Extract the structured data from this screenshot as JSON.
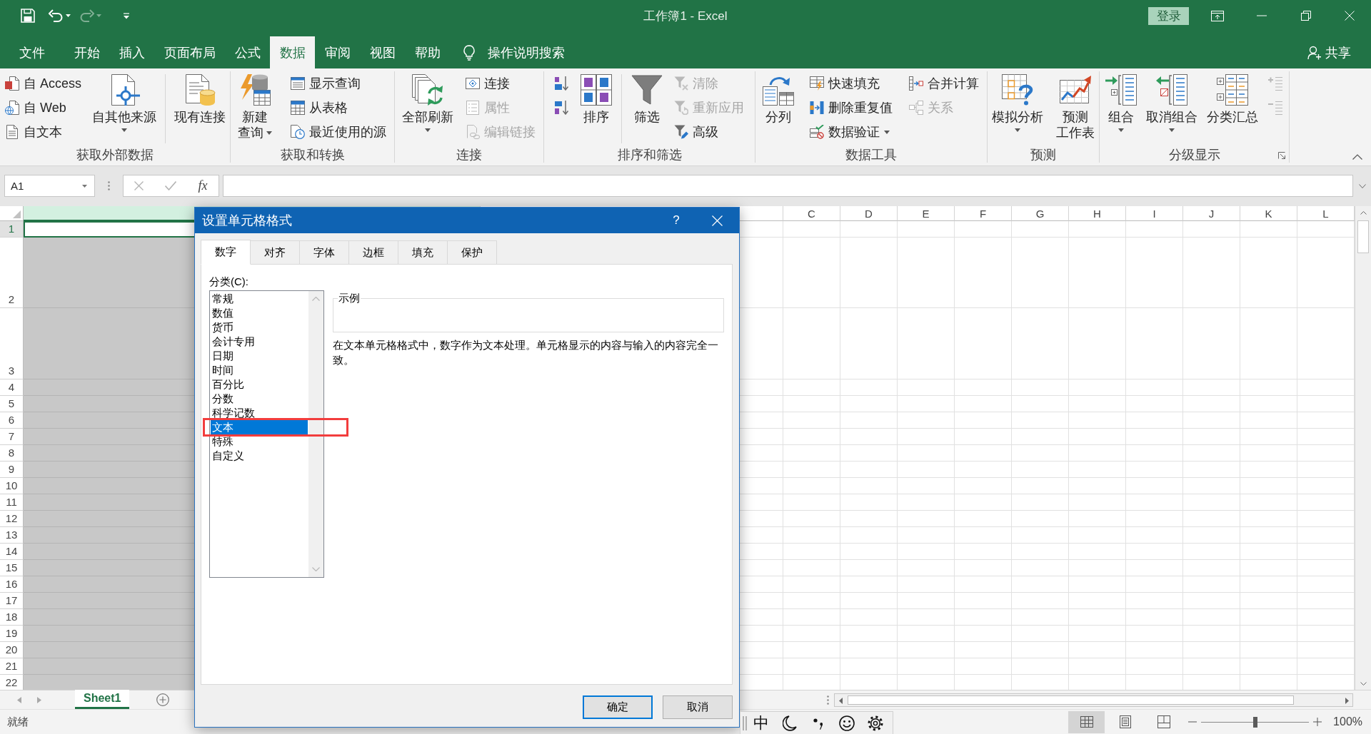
{
  "window": {
    "title": "工作簿1 - Excel",
    "sign_in": "登录"
  },
  "ribbon_tabs": [
    {
      "label": "文件",
      "selected": false
    },
    {
      "label": "开始",
      "selected": false
    },
    {
      "label": "插入",
      "selected": false
    },
    {
      "label": "页面布局",
      "selected": false
    },
    {
      "label": "公式",
      "selected": false
    },
    {
      "label": "数据",
      "selected": true
    },
    {
      "label": "审阅",
      "selected": false
    },
    {
      "label": "视图",
      "selected": false
    },
    {
      "label": "帮助",
      "selected": false
    }
  ],
  "tell_me": {
    "label": "操作说明搜索"
  },
  "share": {
    "label": "共享"
  },
  "ribbon_groups": [
    {
      "label": "获取外部数据",
      "columns": [
        {
          "kind": "stack",
          "items": [
            {
              "label": "自 Access",
              "disabled": false,
              "dropdown": false
            },
            {
              "label": "自 Web",
              "disabled": false,
              "dropdown": false
            },
            {
              "label": "自文本",
              "disabled": false,
              "dropdown": false
            }
          ]
        },
        {
          "kind": "large",
          "label_lines": [
            "自其他来源"
          ],
          "dropdown": true
        },
        {
          "kind": "separator"
        },
        {
          "kind": "large",
          "label_lines": [
            "现有连接"
          ],
          "dropdown": false
        }
      ]
    },
    {
      "label": "获取和转换",
      "columns": [
        {
          "kind": "large",
          "label_lines": [
            "新建",
            "查询"
          ],
          "dropdown": true
        },
        {
          "kind": "stack",
          "items": [
            {
              "label": "显示查询",
              "disabled": false,
              "dropdown": false
            },
            {
              "label": "从表格",
              "disabled": false,
              "dropdown": false
            },
            {
              "label": "最近使用的源",
              "disabled": false,
              "dropdown": false
            }
          ]
        }
      ]
    },
    {
      "label": "连接",
      "columns": [
        {
          "kind": "large",
          "label_lines": [
            "全部刷新"
          ],
          "dropdown": true
        },
        {
          "kind": "stack",
          "items": [
            {
              "label": "连接",
              "disabled": false,
              "dropdown": false
            },
            {
              "label": "属性",
              "disabled": true,
              "dropdown": false
            },
            {
              "label": "编辑链接",
              "disabled": true,
              "dropdown": false
            }
          ]
        }
      ]
    },
    {
      "label": "排序和筛选",
      "columns": [
        {
          "kind": "icons",
          "items": [
            {
              "disabled": false
            },
            {
              "disabled": false
            }
          ]
        },
        {
          "kind": "large",
          "label_lines": [
            "排序"
          ],
          "dropdown": false
        },
        {
          "kind": "separator"
        },
        {
          "kind": "large",
          "label_lines": [
            "筛选"
          ],
          "dropdown": false
        },
        {
          "kind": "stack",
          "items": [
            {
              "label": "清除",
              "disabled": true,
              "dropdown": false
            },
            {
              "label": "重新应用",
              "disabled": true,
              "dropdown": false
            },
            {
              "label": "高级",
              "disabled": false,
              "dropdown": false
            }
          ]
        }
      ]
    },
    {
      "label": "数据工具",
      "columns": [
        {
          "kind": "large",
          "label_lines": [
            "分列"
          ],
          "dropdown": false
        },
        {
          "kind": "stack",
          "items": [
            {
              "label": "快速填充",
              "disabled": false,
              "dropdown": false
            },
            {
              "label": "删除重复值",
              "disabled": false,
              "dropdown": false
            },
            {
              "label": "数据验证",
              "disabled": false,
              "dropdown": true
            }
          ]
        },
        {
          "kind": "stack",
          "items": [
            {
              "label": "合并计算",
              "disabled": false,
              "dropdown": false
            },
            {
              "label": "关系",
              "disabled": true,
              "dropdown": false
            }
          ]
        }
      ]
    },
    {
      "label": "预测",
      "columns": [
        {
          "kind": "large",
          "label_lines": [
            "模拟分析"
          ],
          "dropdown": true
        },
        {
          "kind": "large",
          "label_lines": [
            "预测",
            "工作表"
          ],
          "dropdown": false
        }
      ]
    },
    {
      "label": "分级显示",
      "launcher": true,
      "columns": [
        {
          "kind": "large",
          "label_lines": [
            "组合"
          ],
          "dropdown": true
        },
        {
          "kind": "large",
          "label_lines": [
            "取消组合"
          ],
          "dropdown": true
        },
        {
          "kind": "large",
          "label_lines": [
            "分类汇总"
          ],
          "dropdown": false
        },
        {
          "kind": "icons",
          "items": [
            {
              "disabled": true
            },
            {
              "disabled": true
            }
          ]
        }
      ]
    }
  ],
  "formula_bar": {
    "name_box": "A1",
    "enter_disabled": true,
    "function_label": "fx"
  },
  "sheet": {
    "columns": [
      {
        "selected": true
      },
      {
        "selected": false
      },
      {
        "label": "C",
        "selected": false
      },
      {
        "label": "D",
        "selected": false
      },
      {
        "label": "E",
        "selected": false
      },
      {
        "label": "F",
        "selected": false
      },
      {
        "label": "G",
        "selected": false
      },
      {
        "label": "H",
        "selected": false
      },
      {
        "label": "I",
        "selected": false
      },
      {
        "label": "J",
        "selected": false
      },
      {
        "label": "K",
        "selected": false
      },
      {
        "label": "L",
        "selected": false
      }
    ],
    "rows": [
      {
        "label": "1",
        "selected": true
      },
      {
        "label": "2",
        "selected": false
      },
      {
        "label": "3",
        "selected": false
      },
      {
        "label": "4",
        "selected": false
      },
      {
        "label": "5",
        "selected": false
      },
      {
        "label": "6",
        "selected": false
      },
      {
        "label": "7",
        "selected": false
      },
      {
        "label": "8",
        "selected": false
      },
      {
        "label": "9",
        "selected": false
      },
      {
        "label": "10",
        "selected": false
      },
      {
        "label": "11",
        "selected": false
      },
      {
        "label": "12",
        "selected": false
      },
      {
        "label": "13",
        "selected": false
      },
      {
        "label": "14",
        "selected": false
      },
      {
        "label": "15",
        "selected": false
      },
      {
        "label": "16",
        "selected": false
      },
      {
        "label": "17",
        "selected": false
      },
      {
        "label": "18",
        "selected": false
      },
      {
        "label": "19",
        "selected": false
      },
      {
        "label": "20",
        "selected": false
      },
      {
        "label": "21",
        "selected": false
      },
      {
        "label": "22",
        "selected": false
      }
    ]
  },
  "sheet_tabs": [
    {
      "label": "Sheet1",
      "selected": true
    }
  ],
  "status_bar": {
    "status": "就绪",
    "views": [
      {
        "selected": true
      },
      {
        "selected": false
      },
      {
        "selected": false
      }
    ],
    "zoom": {
      "level": 0.5,
      "reading": "100%"
    }
  },
  "dialog": {
    "title": "设置单元格格式",
    "help": "?",
    "tabs": [
      {
        "label": "数字",
        "selected": true
      },
      {
        "label": "对齐",
        "selected": false
      },
      {
        "label": "字体",
        "selected": false
      },
      {
        "label": "边框",
        "selected": false
      },
      {
        "label": "填充",
        "selected": false
      },
      {
        "label": "保护",
        "selected": false
      }
    ],
    "category_label": "分类(C):",
    "categories": [
      {
        "label": "常规",
        "selected": false,
        "highlighted": false
      },
      {
        "label": "数值",
        "selected": false,
        "highlighted": false
      },
      {
        "label": "货币",
        "selected": false,
        "highlighted": false
      },
      {
        "label": "会计专用",
        "selected": false,
        "highlighted": false
      },
      {
        "label": "日期",
        "selected": false,
        "highlighted": false
      },
      {
        "label": "时间",
        "selected": false,
        "highlighted": false
      },
      {
        "label": "百分比",
        "selected": false,
        "highlighted": false
      },
      {
        "label": "分数",
        "selected": false,
        "highlighted": false
      },
      {
        "label": "科学记数",
        "selected": false,
        "highlighted": false
      },
      {
        "label": "文本",
        "selected": true,
        "highlighted": true
      },
      {
        "label": "特殊",
        "selected": false,
        "highlighted": false
      },
      {
        "label": "自定义",
        "selected": false,
        "highlighted": false
      }
    ],
    "sample_label": "示例",
    "description": "在文本单元格格式中，数字作为文本处理。单元格显示的内容与输入的内容完全一致。",
    "buttons": [
      {
        "label": "确定",
        "default": true
      },
      {
        "label": "取消",
        "default": false
      }
    ]
  },
  "ime_toolbar": {
    "mode": "中"
  }
}
